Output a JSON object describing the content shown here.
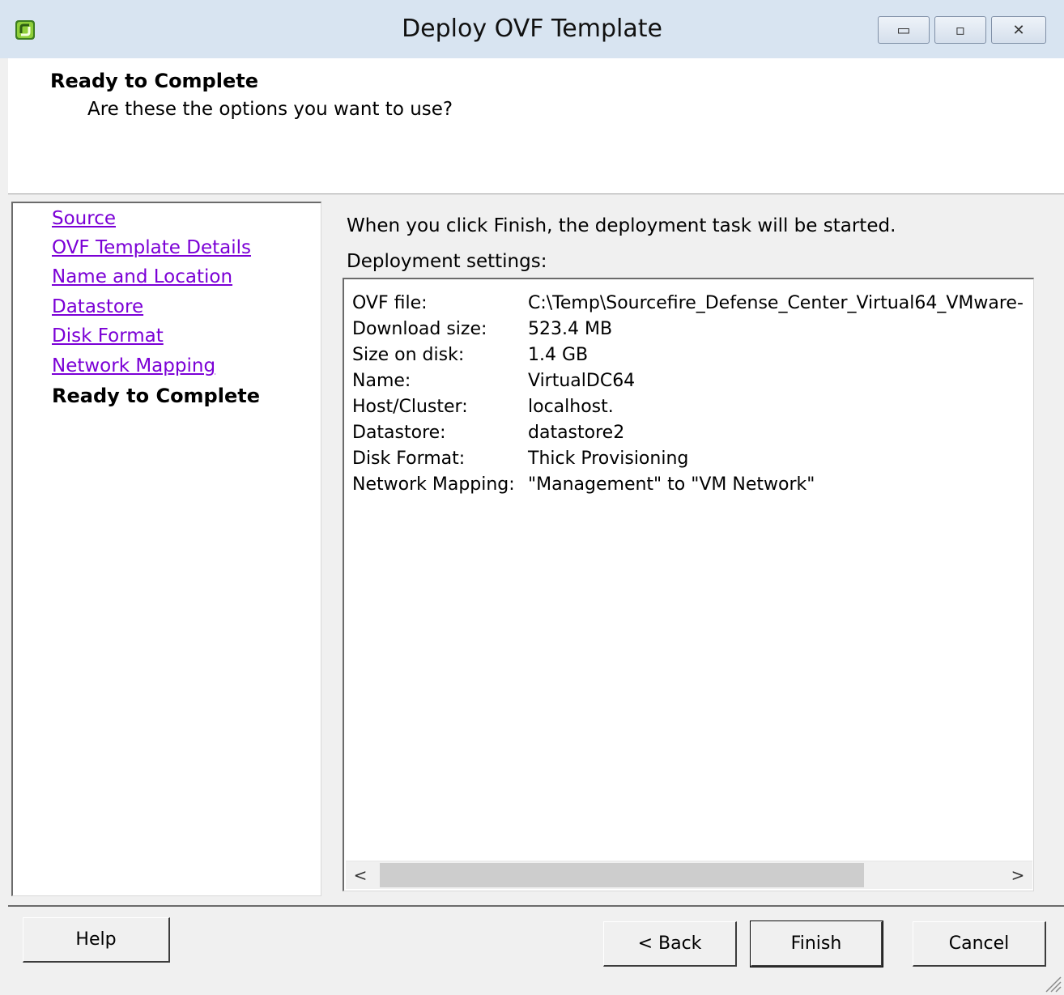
{
  "window": {
    "title": "Deploy OVF Template",
    "controls": {
      "minimize": "▭",
      "maximize": "▫",
      "close": "✕"
    }
  },
  "header": {
    "title": "Ready to Complete",
    "subtitle": "Are these the options you want to use?"
  },
  "steps": [
    {
      "label": "Source"
    },
    {
      "label": "OVF Template Details"
    },
    {
      "label": "Name and Location"
    },
    {
      "label": "Datastore"
    },
    {
      "label": "Disk Format"
    },
    {
      "label": "Network Mapping"
    },
    {
      "label": "Ready to Complete"
    }
  ],
  "content": {
    "info": "When you click Finish, the deployment task will be started.",
    "settings_label": "Deployment settings:",
    "settings": [
      {
        "key": "OVF file:",
        "value": "C:\\Temp\\Sourcefire_Defense_Center_Virtual64_VMware-"
      },
      {
        "key": "Download size:",
        "value": "523.4 MB"
      },
      {
        "key": "Size on disk:",
        "value": "1.4 GB"
      },
      {
        "key": "Name:",
        "value": "VirtualDC64"
      },
      {
        "key": "Host/Cluster:",
        "value": "localhost."
      },
      {
        "key": "Datastore:",
        "value": "datastore2"
      },
      {
        "key": "Disk Format:",
        "value": "Thick Provisioning"
      },
      {
        "key": "Network Mapping:",
        "value": "\"Management\" to \"VM Network\""
      }
    ],
    "scroll_left": "<",
    "scroll_right": ">"
  },
  "buttons": {
    "help": "Help",
    "back": "< Back",
    "finish": "Finish",
    "cancel": "Cancel"
  },
  "colors": {
    "link": "#7b00d6",
    "titlebar": "#d8e4f1",
    "dialog_bg": "#f0f0f0"
  },
  "icons": {
    "app": "vsphere-icon",
    "resize": "resize-grip-icon"
  }
}
